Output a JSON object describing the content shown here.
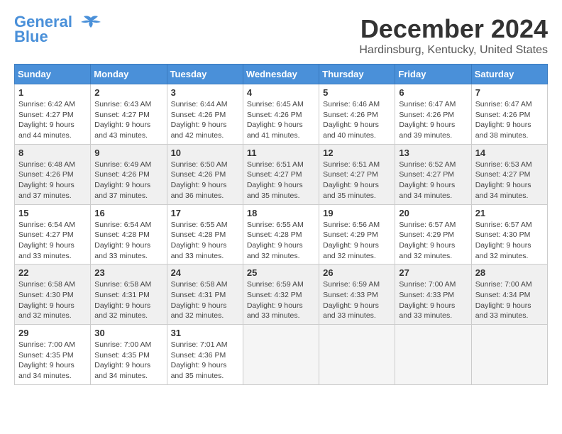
{
  "logo": {
    "line1": "General",
    "line2": "Blue"
  },
  "title": "December 2024",
  "subtitle": "Hardinsburg, Kentucky, United States",
  "weekdays": [
    "Sunday",
    "Monday",
    "Tuesday",
    "Wednesday",
    "Thursday",
    "Friday",
    "Saturday"
  ],
  "weeks": [
    [
      {
        "day": "1",
        "sunrise": "6:42 AM",
        "sunset": "4:27 PM",
        "daylight": "9 hours and 44 minutes."
      },
      {
        "day": "2",
        "sunrise": "6:43 AM",
        "sunset": "4:27 PM",
        "daylight": "9 hours and 43 minutes."
      },
      {
        "day": "3",
        "sunrise": "6:44 AM",
        "sunset": "4:26 PM",
        "daylight": "9 hours and 42 minutes."
      },
      {
        "day": "4",
        "sunrise": "6:45 AM",
        "sunset": "4:26 PM",
        "daylight": "9 hours and 41 minutes."
      },
      {
        "day": "5",
        "sunrise": "6:46 AM",
        "sunset": "4:26 PM",
        "daylight": "9 hours and 40 minutes."
      },
      {
        "day": "6",
        "sunrise": "6:47 AM",
        "sunset": "4:26 PM",
        "daylight": "9 hours and 39 minutes."
      },
      {
        "day": "7",
        "sunrise": "6:47 AM",
        "sunset": "4:26 PM",
        "daylight": "9 hours and 38 minutes."
      }
    ],
    [
      {
        "day": "8",
        "sunrise": "6:48 AM",
        "sunset": "4:26 PM",
        "daylight": "9 hours and 37 minutes."
      },
      {
        "day": "9",
        "sunrise": "6:49 AM",
        "sunset": "4:26 PM",
        "daylight": "9 hours and 37 minutes."
      },
      {
        "day": "10",
        "sunrise": "6:50 AM",
        "sunset": "4:26 PM",
        "daylight": "9 hours and 36 minutes."
      },
      {
        "day": "11",
        "sunrise": "6:51 AM",
        "sunset": "4:27 PM",
        "daylight": "9 hours and 35 minutes."
      },
      {
        "day": "12",
        "sunrise": "6:51 AM",
        "sunset": "4:27 PM",
        "daylight": "9 hours and 35 minutes."
      },
      {
        "day": "13",
        "sunrise": "6:52 AM",
        "sunset": "4:27 PM",
        "daylight": "9 hours and 34 minutes."
      },
      {
        "day": "14",
        "sunrise": "6:53 AM",
        "sunset": "4:27 PM",
        "daylight": "9 hours and 34 minutes."
      }
    ],
    [
      {
        "day": "15",
        "sunrise": "6:54 AM",
        "sunset": "4:27 PM",
        "daylight": "9 hours and 33 minutes."
      },
      {
        "day": "16",
        "sunrise": "6:54 AM",
        "sunset": "4:28 PM",
        "daylight": "9 hours and 33 minutes."
      },
      {
        "day": "17",
        "sunrise": "6:55 AM",
        "sunset": "4:28 PM",
        "daylight": "9 hours and 33 minutes."
      },
      {
        "day": "18",
        "sunrise": "6:55 AM",
        "sunset": "4:28 PM",
        "daylight": "9 hours and 32 minutes."
      },
      {
        "day": "19",
        "sunrise": "6:56 AM",
        "sunset": "4:29 PM",
        "daylight": "9 hours and 32 minutes."
      },
      {
        "day": "20",
        "sunrise": "6:57 AM",
        "sunset": "4:29 PM",
        "daylight": "9 hours and 32 minutes."
      },
      {
        "day": "21",
        "sunrise": "6:57 AM",
        "sunset": "4:30 PM",
        "daylight": "9 hours and 32 minutes."
      }
    ],
    [
      {
        "day": "22",
        "sunrise": "6:58 AM",
        "sunset": "4:30 PM",
        "daylight": "9 hours and 32 minutes."
      },
      {
        "day": "23",
        "sunrise": "6:58 AM",
        "sunset": "4:31 PM",
        "daylight": "9 hours and 32 minutes."
      },
      {
        "day": "24",
        "sunrise": "6:58 AM",
        "sunset": "4:31 PM",
        "daylight": "9 hours and 32 minutes."
      },
      {
        "day": "25",
        "sunrise": "6:59 AM",
        "sunset": "4:32 PM",
        "daylight": "9 hours and 33 minutes."
      },
      {
        "day": "26",
        "sunrise": "6:59 AM",
        "sunset": "4:33 PM",
        "daylight": "9 hours and 33 minutes."
      },
      {
        "day": "27",
        "sunrise": "7:00 AM",
        "sunset": "4:33 PM",
        "daylight": "9 hours and 33 minutes."
      },
      {
        "day": "28",
        "sunrise": "7:00 AM",
        "sunset": "4:34 PM",
        "daylight": "9 hours and 33 minutes."
      }
    ],
    [
      {
        "day": "29",
        "sunrise": "7:00 AM",
        "sunset": "4:35 PM",
        "daylight": "9 hours and 34 minutes."
      },
      {
        "day": "30",
        "sunrise": "7:00 AM",
        "sunset": "4:35 PM",
        "daylight": "9 hours and 34 minutes."
      },
      {
        "day": "31",
        "sunrise": "7:01 AM",
        "sunset": "4:36 PM",
        "daylight": "9 hours and 35 minutes."
      },
      null,
      null,
      null,
      null
    ]
  ]
}
